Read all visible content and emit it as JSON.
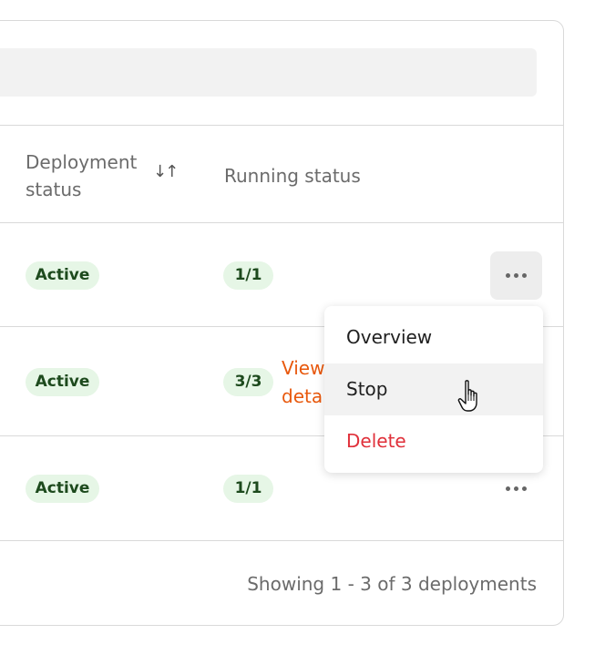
{
  "table": {
    "headers": {
      "deployment_status": "Deployment status",
      "running_status": "Running status"
    },
    "rows": [
      {
        "status": "Active",
        "running": "1/1"
      },
      {
        "status": "Active",
        "running": "3/3",
        "link": "View\ndetai"
      },
      {
        "status": "Active",
        "running": "1/1"
      }
    ]
  },
  "menu": {
    "items": [
      "Overview",
      "Stop",
      "Delete"
    ]
  },
  "footer": {
    "summary": "Showing 1 - 3 of 3 deployments"
  },
  "icons": {
    "sort": "sort-icon",
    "more": "more-horizontal-icon",
    "cursor": "hand-pointer-icon"
  },
  "colors": {
    "pill_bg": "#e6f6e6",
    "pill_text": "#1d4a1d",
    "link": "#e8580c",
    "danger": "#e0303a"
  }
}
